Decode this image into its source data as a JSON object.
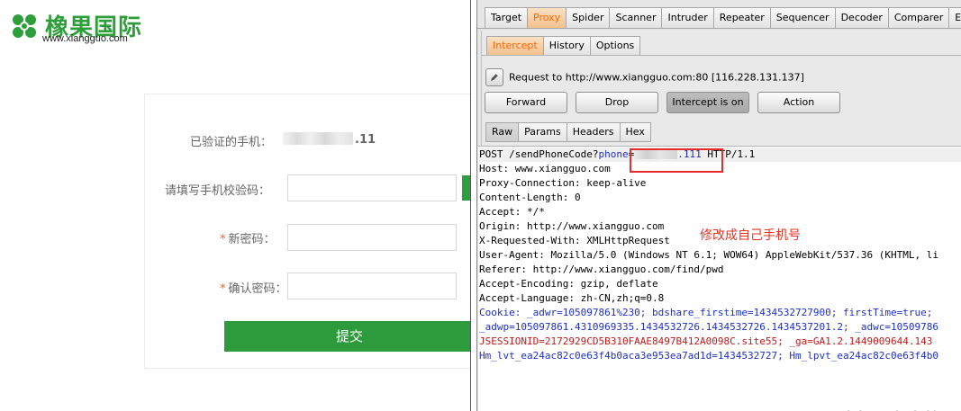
{
  "site": {
    "logo_title": "橡果国际",
    "logo_url": "www.xiangguo.com",
    "verified_label": "已验证的手机：",
    "verified_phone_tail": ".11",
    "code_label": "请填写手机校验码：",
    "new_pwd_label": "新密码：",
    "confirm_pwd_label": "确认密码：",
    "required_mark": "*",
    "submit_label": "提交",
    "colors": {
      "brand_green": "#2d9a3c",
      "required": "#ff5e2b"
    }
  },
  "burp": {
    "main_tabs": [
      "Target",
      "Proxy",
      "Spider",
      "Scanner",
      "Intruder",
      "Repeater",
      "Sequencer",
      "Decoder",
      "Comparer",
      "Ext"
    ],
    "main_active": "Proxy",
    "proxy_tabs": [
      "Intercept",
      "History",
      "Options"
    ],
    "proxy_active": "Intercept",
    "request_info": "Request to http://www.xiangguo.com:80  [116.228.131.137]",
    "buttons": {
      "forward": "Forward",
      "drop": "Drop",
      "intercept": "Intercept is on",
      "action": "Action"
    },
    "view_tabs": [
      "Raw",
      "Params",
      "Headers",
      "Hex"
    ],
    "view_active": "Raw",
    "request": {
      "line1_pre": "POST /sendPhoneCode?",
      "line1_param": "phone",
      "line1_eq": "=",
      "line1_val_tail": ".111",
      "line1_post": " HTTP/1.1",
      "headers": [
        "Host: www.xiangguo.com",
        "Proxy-Connection: keep-alive",
        "Content-Length: 0",
        "Accept: */*",
        "Origin: http://www.xiangguo.com",
        "X-Requested-With: XMLHttpRequest",
        "User-Agent: Mozilla/5.0 (Windows NT 6.1; WOW64) AppleWebKit/537.36 (KHTML, li",
        "Referer: http://www.xiangguo.com/find/pwd",
        "Accept-Encoding: gzip, deflate",
        "Accept-Language: zh-CN,zh;q=0.8"
      ],
      "cookie_line1": "Cookie: _adwr=105097861%230; bdshare_firstime=1434532727900; firstTime=true;",
      "cookie_line2": "_adwp=105097861.4310969335.1434532726.1434532726.1434537201.2; _adwc=10509786",
      "cookie_line3": "JSESSIONID=2172929CD5B310FAAE8497B412A0098C.site55; _ga=GA1.2.1449009644.143",
      "cookie_line4": "Hm_lvt_ea24ac82c0e63f4b0aca3e953ea7ad1d=1434532727; Hm_lpvt_ea24ac82c0e63f4b0"
    },
    "annotation": "修改成自己手机号",
    "watermark": "www.wooyun.org",
    "colors": {
      "active_tab_text": "#ff6600",
      "highlight_box": "#e52b2b",
      "annotation": "#e8321f"
    }
  }
}
